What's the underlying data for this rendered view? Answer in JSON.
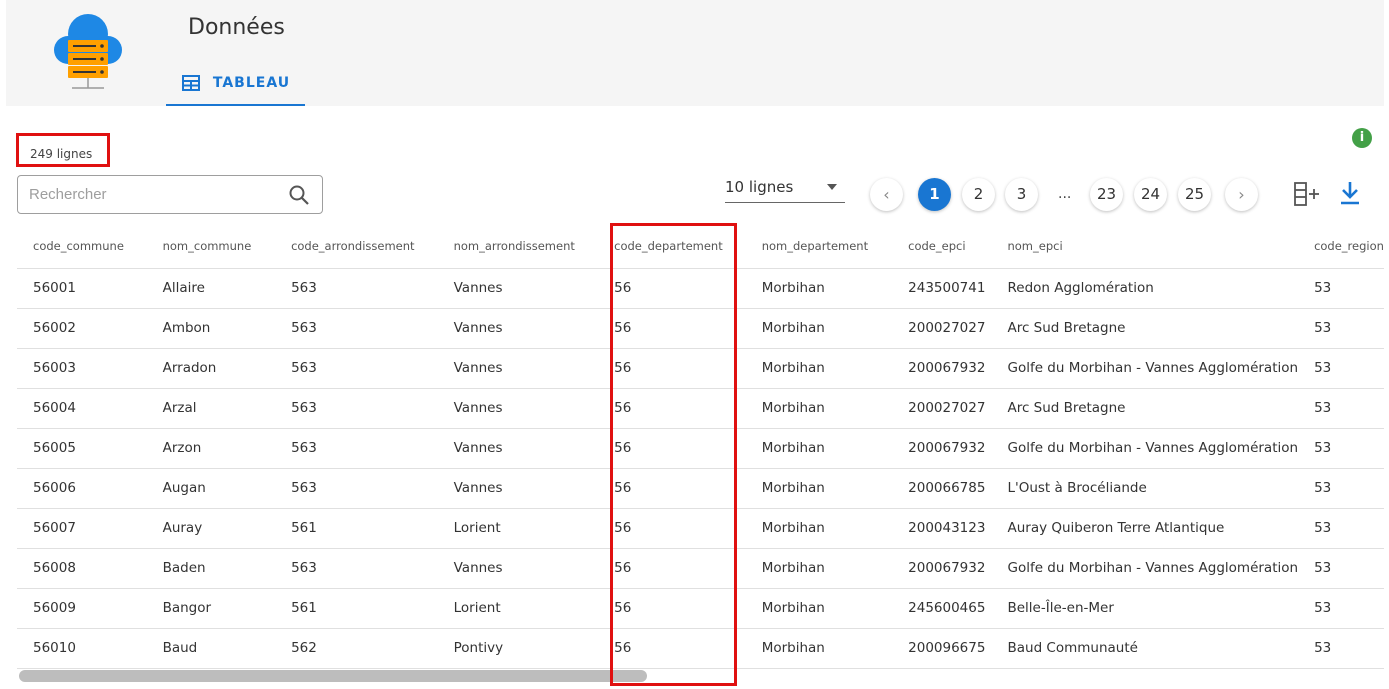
{
  "header": {
    "title": "Données",
    "tab_label": "TABLEAU"
  },
  "toolbar": {
    "row_count": "249 lignes",
    "search_placeholder": "Rechercher",
    "rows_per_page": "10 lignes",
    "pages": [
      "1",
      "2",
      "3",
      "...",
      "23",
      "24",
      "25"
    ],
    "current_page": "1",
    "prev_label": "‹",
    "next_label": "›",
    "info_label": "i"
  },
  "table": {
    "columns": [
      "code_commune",
      "nom_commune",
      "code_arrondissement",
      "nom_arrondissement",
      "code_departement",
      "nom_departement",
      "code_epci",
      "nom_epci",
      "code_region"
    ],
    "rows": [
      [
        "56001",
        "Allaire",
        "563",
        "Vannes",
        "56",
        "Morbihan",
        "243500741",
        "Redon Agglomération",
        "53"
      ],
      [
        "56002",
        "Ambon",
        "563",
        "Vannes",
        "56",
        "Morbihan",
        "200027027",
        "Arc Sud Bretagne",
        "53"
      ],
      [
        "56003",
        "Arradon",
        "563",
        "Vannes",
        "56",
        "Morbihan",
        "200067932",
        "Golfe du Morbihan - Vannes Agglomération",
        "53"
      ],
      [
        "56004",
        "Arzal",
        "563",
        "Vannes",
        "56",
        "Morbihan",
        "200027027",
        "Arc Sud Bretagne",
        "53"
      ],
      [
        "56005",
        "Arzon",
        "563",
        "Vannes",
        "56",
        "Morbihan",
        "200067932",
        "Golfe du Morbihan - Vannes Agglomération",
        "53"
      ],
      [
        "56006",
        "Augan",
        "563",
        "Vannes",
        "56",
        "Morbihan",
        "200066785",
        "L'Oust à Brocéliande",
        "53"
      ],
      [
        "56007",
        "Auray",
        "561",
        "Lorient",
        "56",
        "Morbihan",
        "200043123",
        "Auray Quiberon Terre Atlantique",
        "53"
      ],
      [
        "56008",
        "Baden",
        "563",
        "Vannes",
        "56",
        "Morbihan",
        "200067932",
        "Golfe du Morbihan - Vannes Agglomération",
        "53"
      ],
      [
        "56009",
        "Bangor",
        "561",
        "Lorient",
        "56",
        "Morbihan",
        "245600465",
        "Belle-Île-en-Mer",
        "53"
      ],
      [
        "56010",
        "Baud",
        "562",
        "Pontivy",
        "56",
        "Morbihan",
        "200096675",
        "Baud Communauté",
        "53"
      ]
    ]
  },
  "colors": {
    "primary": "#1976d2",
    "highlight": "#e01010",
    "info": "#43a047"
  },
  "icons": {
    "logo": "cloud-server-icon",
    "tab": "table-icon",
    "search": "search-icon",
    "columns": "add-column-icon",
    "download": "download-icon",
    "info": "info-icon"
  }
}
